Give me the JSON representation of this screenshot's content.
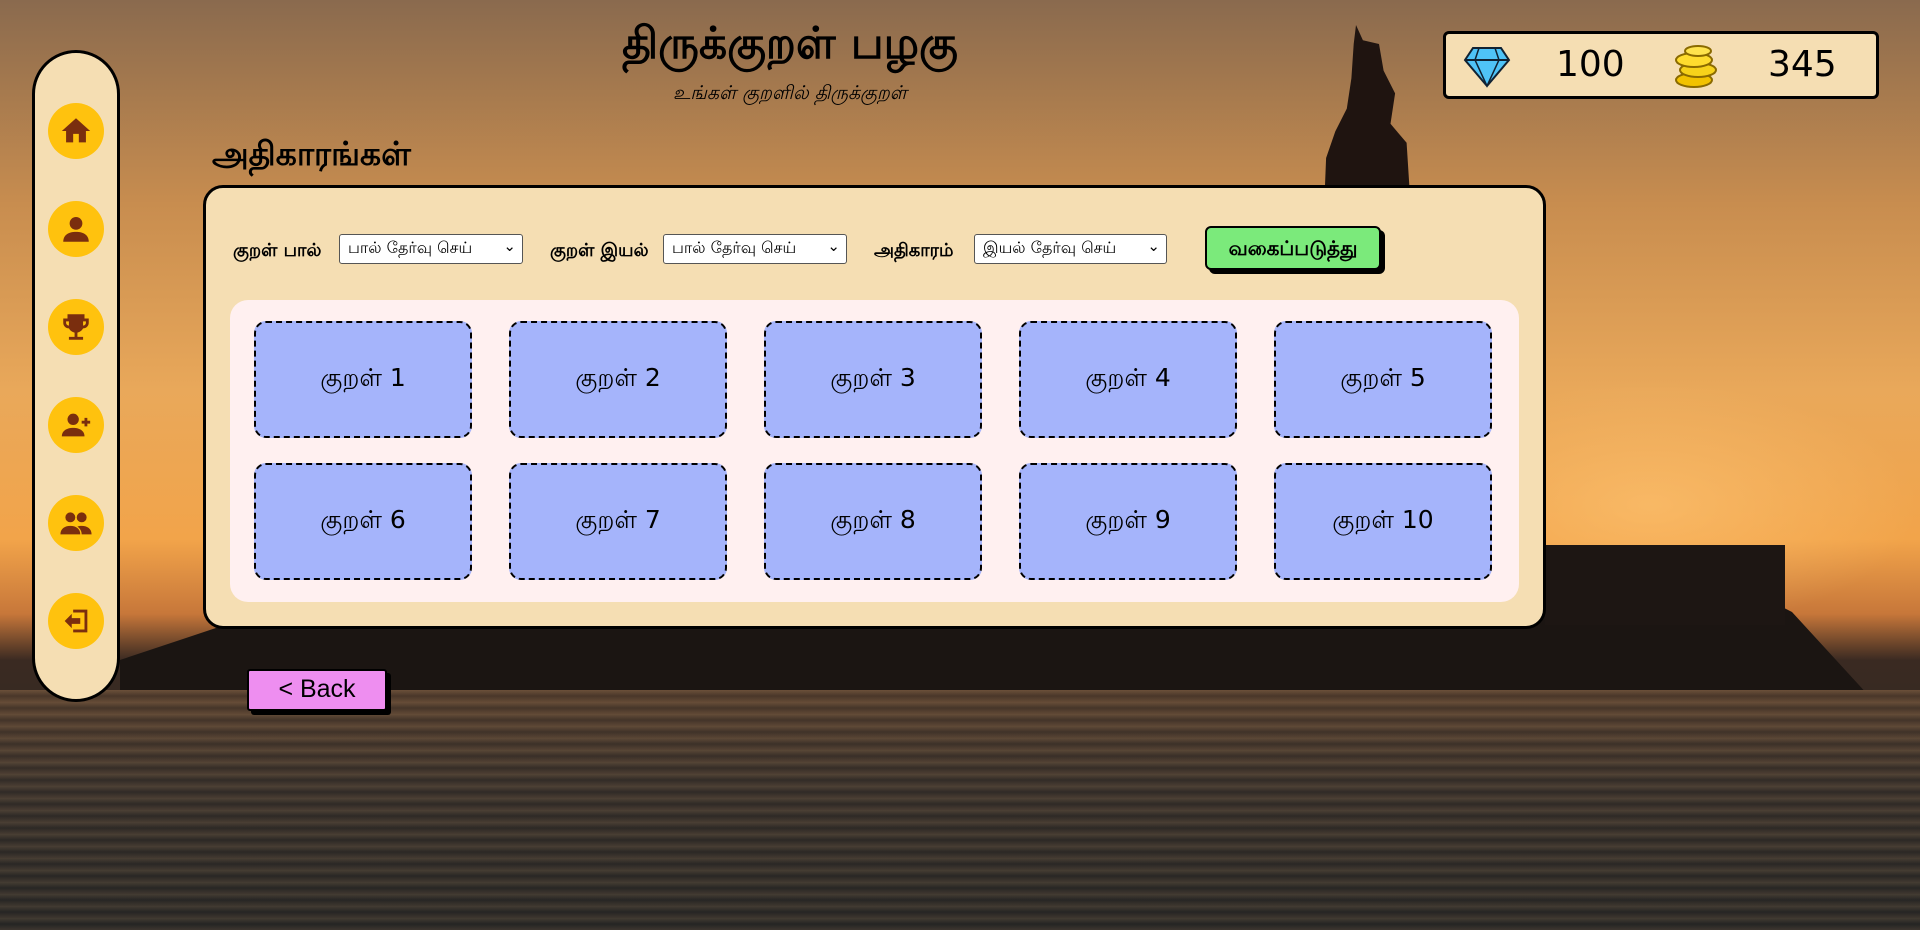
{
  "header": {
    "title": "திருக்குறள் பழகு",
    "subtitle": "உங்கள் குறளில் திருக்குறள்"
  },
  "stats": {
    "gems": "100",
    "coins": "345",
    "gem_icon": "diamond-icon",
    "coin_icon": "coins-icon"
  },
  "sidebar": {
    "items": [
      {
        "icon": "home-icon"
      },
      {
        "icon": "user-icon"
      },
      {
        "icon": "trophy-icon"
      },
      {
        "icon": "add-user-icon"
      },
      {
        "icon": "users-icon"
      },
      {
        "icon": "logout-icon"
      }
    ]
  },
  "section_title": "அதிகாரங்கள்",
  "filters": {
    "paal_label": "குறள் பால்",
    "paal_value": "பால் தேர்வு செய்",
    "iyal_label": "குறள் இயல்",
    "iyal_value": "பால் தேர்வு செய்",
    "adhikaram_label": "அதிகாரம்",
    "adhikaram_value": "இயல் தேர்வு செய்",
    "sort_label": "வகைப்படுத்து"
  },
  "kurals": [
    "குறள் 1",
    "குறள் 2",
    "குறள் 3",
    "குறள் 4",
    "குறள் 5",
    "குறள் 6",
    "குறள் 7",
    "குறள் 8",
    "குறள் 9",
    "குறள் 10"
  ],
  "back_label": "< Back",
  "colors": {
    "panel": "#f5deb3",
    "nav_button": "#ffc20e",
    "card": "#a5b4fb",
    "sort_button": "#7bea7b",
    "back_button": "#ee8ef0"
  }
}
